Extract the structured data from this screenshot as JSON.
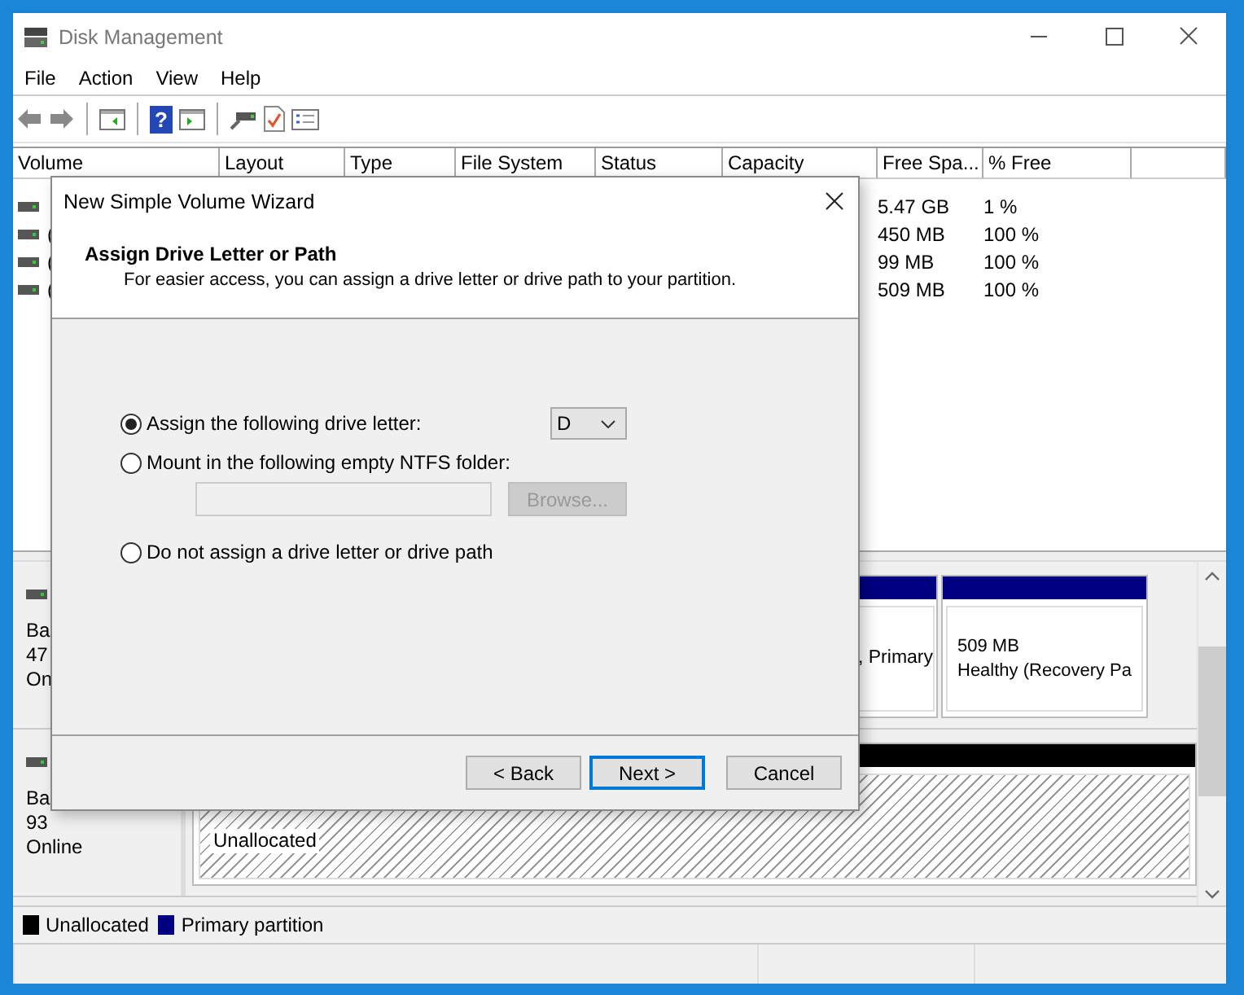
{
  "window": {
    "title": "Disk Management"
  },
  "menu": [
    "File",
    "Action",
    "View",
    "Help"
  ],
  "toolbar": {
    "help_glyph": "?"
  },
  "volume_list": {
    "columns": [
      "Volume",
      "Layout",
      "Type",
      "File System",
      "Status",
      "Capacity",
      "Free Spa...",
      "% Free"
    ],
    "rows": [
      {
        "free_space": "5.47 GB",
        "percent_free": "1 %"
      },
      {
        "volume": "(",
        "free_space": "450 MB",
        "percent_free": "100 %"
      },
      {
        "volume": "(",
        "free_space": "99 MB",
        "percent_free": "100 %"
      },
      {
        "volume": "(",
        "free_space": "509 MB",
        "percent_free": "100 %"
      }
    ]
  },
  "disks": [
    {
      "label": [
        "Ba",
        "47",
        "On"
      ],
      "partitions": [
        {
          "kind": "primary",
          "lines": [
            ", Primary"
          ]
        },
        {
          "kind": "primary",
          "lines": [
            "509 MB",
            "Healthy (Recovery Pa"
          ]
        }
      ]
    },
    {
      "label": [
        "Ba",
        "93",
        "Online"
      ],
      "partitions": [
        {
          "kind": "unallocated",
          "lines": [
            "Unallocated"
          ]
        }
      ]
    }
  ],
  "legend": [
    {
      "label": "Unallocated",
      "color": "#000000"
    },
    {
      "label": "Primary partition",
      "color": "#000080"
    }
  ],
  "dialog": {
    "title": "New Simple Volume Wizard",
    "heading": "Assign Drive Letter or Path",
    "subtitle": "For easier access, you can assign a drive letter or drive path to your partition.",
    "options": [
      {
        "kind": "drive_letter",
        "label": "Assign the following drive letter:",
        "selected": true,
        "value": "D"
      },
      {
        "kind": "folder",
        "label": "Mount in the following empty NTFS folder:",
        "selected": false,
        "button": "Browse...",
        "disabled": true
      },
      {
        "kind": "none",
        "label": "Do not assign a drive letter or drive path",
        "selected": false
      }
    ],
    "buttons": [
      {
        "label": "< Back",
        "default": false
      },
      {
        "label": "Next >",
        "default": true
      },
      {
        "label": "Cancel",
        "default": false
      }
    ]
  }
}
